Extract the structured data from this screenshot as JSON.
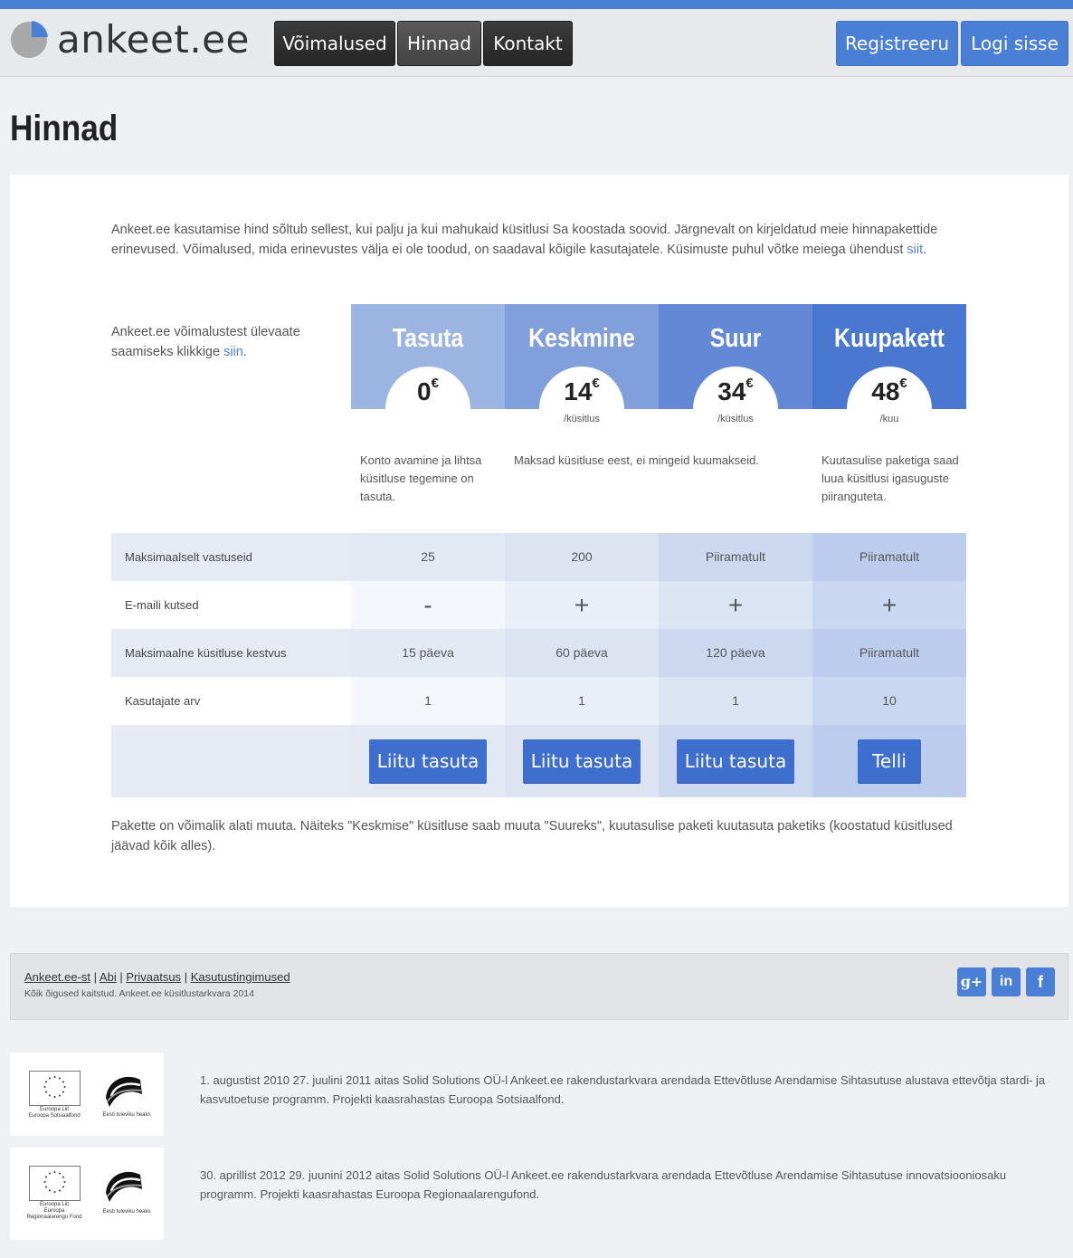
{
  "brand": {
    "name": "ankeet.ee"
  },
  "nav": {
    "items": [
      "Võimalused",
      "Hinnad",
      "Kontakt"
    ],
    "active": 1
  },
  "auth": {
    "register": "Registreeru",
    "login": "Logi sisse"
  },
  "page": {
    "title": "Hinnad"
  },
  "intro": {
    "text": "Ankeet.ee kasutamise hind sõltub sellest, kui palju ja kui mahukaid küsitlusi Sa koostada soovid. Järgnevalt on kirjeldatud meie hinnapakettide erinevused. Võimalused, mida erinevustes välja ei ole toodud, on saadaval kõigile kasutajatele. Küsimuste puhul võtke meiega ühendust ",
    "link": "siit",
    "end": "."
  },
  "side": {
    "text": "Ankeet.ee võimalustest ülevaate saamiseks klikkige ",
    "link": "siin",
    "end": "."
  },
  "plans": [
    {
      "name": "Tasuta",
      "price": "0",
      "currency": "€",
      "per": "",
      "desc": "Konto avamine ja lihtsa küsitluse tegemine on tasuta.",
      "button": "Liitu tasuta",
      "head_color": "#9bb4e2"
    },
    {
      "name": "Keskmine",
      "price": "14",
      "currency": "€",
      "per": "/küsitlus",
      "desc": "Maksad küsitluse eest, ei mingeid kuumakseid.",
      "button": "Liitu tasuta",
      "head_color": "#819fdb"
    },
    {
      "name": "Suur",
      "price": "34",
      "currency": "€",
      "per": "/küsitlus",
      "desc": "",
      "button": "Liitu tasuta",
      "head_color": "#6388d6"
    },
    {
      "name": "Kuupakett",
      "price": "48",
      "currency": "€",
      "per": "/kuu",
      "desc": "Kuutasulise paketiga saad luua küsitlusi igasuguste piiranguteta.",
      "button": "Telli",
      "head_color": "#4a77cf"
    }
  ],
  "features": [
    {
      "label": "Maksimaalselt vastuseid",
      "values": [
        "25",
        "200",
        "Piiramatult",
        "Piiramatult"
      ]
    },
    {
      "label": "E-maili kutsed",
      "values": [
        "-",
        "+",
        "+",
        "+"
      ]
    },
    {
      "label": "Maksimaalne küsitluse kestvus",
      "values": [
        "15 päeva",
        "60 päeva",
        "120 päeva",
        "Piiramatult"
      ]
    },
    {
      "label": "Kasutajate arv",
      "values": [
        "1",
        "1",
        "1",
        "10"
      ]
    }
  ],
  "outro": {
    "text": "Pakette on võimalik alati muuta. Näiteks \"Keskmise\" küsitluse saab muuta \"Suureks\", kuutasulise paketi kuutasuta paketiks (koostatud küsitlused jäävad kõik alles)."
  },
  "footer": {
    "links": [
      "Ankeet.ee-st",
      "Abi",
      "Privaatsus",
      "Kasutustingimused"
    ],
    "separator": "|",
    "copyright": "Kõik õigused kaitstud. Ankeet.ee küsitlustarkvara 2014",
    "social": [
      "g+",
      "in",
      "f"
    ]
  },
  "eu": [
    {
      "label_left": "Euroopa Liit\nEuroopa Sotsiaalfond",
      "label_right": "Eesti tuleviku heaks",
      "text": "1. augustist 2010 27. juulini 2011 aitas Solid Solutions OÜ-l Ankeet.ee rakendustarkvara arendada Ettevõtluse Arendamise Sihtasutuse alustava ettevõtja stardi- ja kasvutoetuse programm. Projekti kaasrahastas Euroopa Sotsiaalfond."
    },
    {
      "label_left": "Euroopa Liit\nEuroopa\nRegionaalarengu Fond",
      "label_right": "Eesti tuleviku heaks",
      "text": "30. aprillist 2012 29. juunini 2012 aitas Solid Solutions OÜ-l Ankeet.ee rakendustarkvara arendada Ettevõtluse Arendamise Sihtasutuse innovatsiooniosaku programm. Projekti kaasrahastas Euroopa Regionaalarengufond."
    }
  ]
}
